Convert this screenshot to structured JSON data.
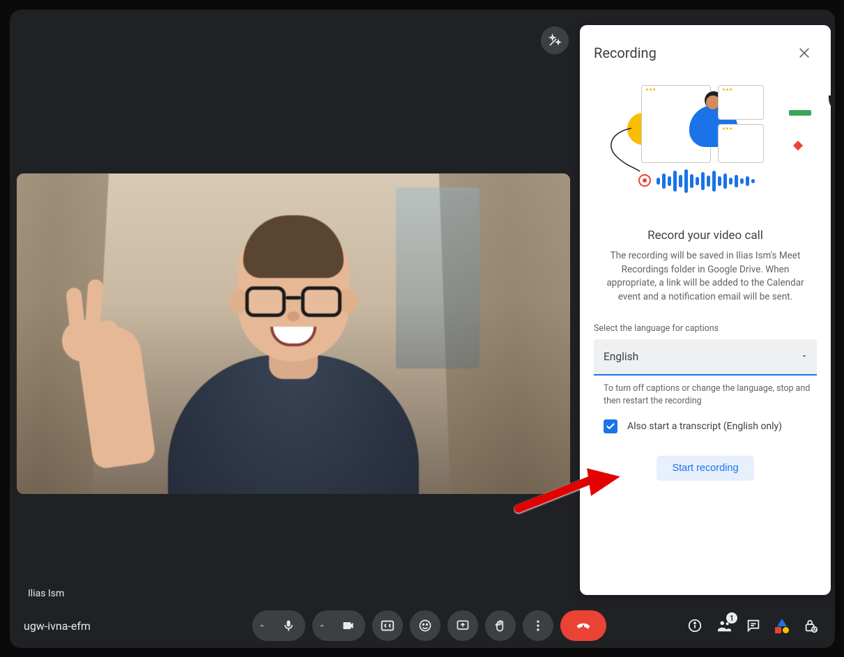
{
  "participant": {
    "name": "Ilias Ism"
  },
  "meeting": {
    "code": "ugw-ivna-efm"
  },
  "panel": {
    "title": "Recording",
    "heading": "Record your video call",
    "description": "The recording will be saved in Ilias Ism's Meet Recordings folder in Google Drive. When appropriate, a link will be added to the Calendar event and a notification email will be sent.",
    "select_label": "Select the language for captions",
    "language": "English",
    "hint": "To turn off captions or change the language, stop and then restart the recording",
    "transcript_checked": true,
    "transcript_label": "Also start a transcript (English only)",
    "start_button": "Start recording"
  },
  "right_icons": {
    "people_badge": "1"
  }
}
